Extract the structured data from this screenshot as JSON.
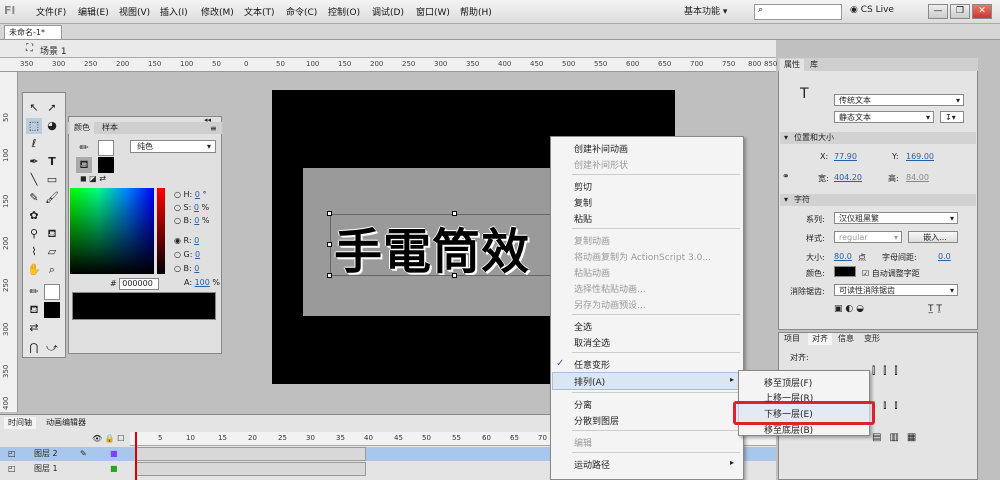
{
  "app": {
    "logo": "Fl"
  },
  "menubar": {
    "items": [
      "文件(F)",
      "编辑(E)",
      "视图(V)",
      "插入(I)",
      "修改(M)",
      "文本(T)",
      "命令(C)",
      "控制(O)",
      "调试(D)",
      "窗口(W)",
      "帮助(H)"
    ],
    "workspace": "基本功能",
    "cslive": "CS Live"
  },
  "document": {
    "tab": "未命名-1*",
    "scene": "场景 1"
  },
  "rulers": {
    "top": [
      "350",
      "300",
      "250",
      "200",
      "150",
      "100",
      "50",
      "0",
      "50",
      "100",
      "150",
      "200",
      "250",
      "300",
      "350",
      "400",
      "450",
      "500",
      "550",
      "600",
      "650",
      "700",
      "750",
      "800",
      "850"
    ],
    "left": [
      "50",
      "100",
      "150",
      "200",
      "250",
      "300",
      "350",
      "400"
    ]
  },
  "stage": {
    "text": "手電筒效"
  },
  "color_panel": {
    "tabs": [
      "颜色",
      "样本"
    ],
    "type": "纯色",
    "h": "0",
    "s": "0",
    "b": "0",
    "r": "0",
    "g": "0",
    "b2": "0",
    "hex": "000000",
    "alpha": "100",
    "labels": {
      "h": "H:",
      "s": "S:",
      "b": "B:",
      "r": "R:",
      "g": "G:",
      "b2": "B:",
      "hash": "#",
      "a": "A:",
      "deg": "°",
      "pct": "%"
    }
  },
  "properties": {
    "tabs": [
      "属性",
      "库"
    ],
    "text_type": "传统文本",
    "text_mode": "静态文本",
    "section_position": "位置和大小",
    "x_label": "X:",
    "x": "77.90",
    "y_label": "Y:",
    "y": "169.00",
    "w_label": "宽:",
    "w": "404.20",
    "h_label": "高:",
    "h": "84.00",
    "section_char": "字符",
    "family_label": "系列:",
    "family": "汉仪粗黑繁",
    "style_label": "样式:",
    "style": "regular",
    "embed": "嵌入...",
    "size_label": "大小:",
    "size": "80.0",
    "size_unit": "点",
    "spacing_label": "字母间距:",
    "spacing": "0.0",
    "color_label": "颜色:",
    "auto_kern": "自动调整字距",
    "aa_label": "消除锯齿:",
    "aa": "可读性消除锯齿"
  },
  "align_panel": {
    "tabs": [
      "项目",
      "对齐",
      "信息",
      "变形"
    ],
    "align_label": "对齐:"
  },
  "timeline": {
    "tabs": [
      "时间轴",
      "动画编辑器"
    ],
    "frames": [
      "5",
      "10",
      "15",
      "20",
      "25",
      "30",
      "35",
      "40",
      "45",
      "50",
      "55",
      "60",
      "65",
      "70"
    ],
    "layers": [
      "图层 2",
      "图层 1"
    ]
  },
  "context_menu": {
    "items": [
      {
        "label": "创建补间动画",
        "disabled": false
      },
      {
        "label": "创建补间形状",
        "disabled": true
      },
      {
        "label": "剪切",
        "disabled": false
      },
      {
        "label": "复制",
        "disabled": false
      },
      {
        "label": "粘贴",
        "disabled": false
      },
      {
        "label": "复制动画",
        "disabled": true
      },
      {
        "label": "将动画复制为 ActionScript 3.0...",
        "disabled": true
      },
      {
        "label": "粘贴动画",
        "disabled": true
      },
      {
        "label": "选择性粘贴动画...",
        "disabled": true
      },
      {
        "label": "另存为动画预设...",
        "disabled": true
      },
      {
        "label": "全选",
        "disabled": false
      },
      {
        "label": "取消全选",
        "disabled": false
      },
      {
        "label": "任意变形",
        "disabled": false
      },
      {
        "label": "排列(A)",
        "disabled": false
      },
      {
        "label": "分离",
        "disabled": false
      },
      {
        "label": "分散到图层",
        "disabled": false
      },
      {
        "label": "编辑",
        "disabled": true
      },
      {
        "label": "运动路径",
        "disabled": false
      }
    ],
    "checkmark": "✓",
    "submenu": [
      "移至顶层(F)",
      "上移一层(R)",
      "下移一层(E)",
      "移至底层(B)"
    ]
  },
  "colors": {
    "accent_red": "#e0222e",
    "highlight": "#dbe6f3",
    "link_blue": "#2a5fa8"
  }
}
